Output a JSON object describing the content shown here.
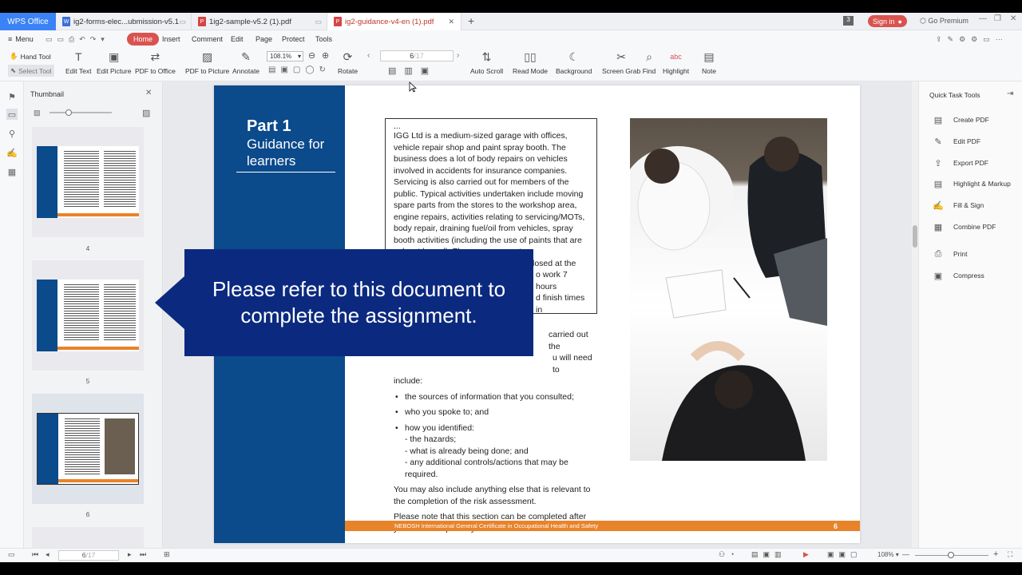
{
  "app": {
    "name": "WPS Office"
  },
  "tabs": [
    {
      "label": "ig2-forms-elec...ubmission-v5.1",
      "icon": "W"
    },
    {
      "label": "1ig2-sample-v5.2 (1).pdf",
      "icon": "P"
    },
    {
      "label": "ig2-guidance-v4-en (1).pdf",
      "icon": "P",
      "active": true
    }
  ],
  "window": {
    "tab_count": "3",
    "sign_in": "Sign in",
    "premium": "Go Premium"
  },
  "menu": {
    "label": "Menu",
    "items": [
      "Home",
      "Insert",
      "Comment",
      "Edit",
      "Page",
      "Protect",
      "Tools"
    ]
  },
  "toolbar": {
    "hand_tool": "Hand Tool",
    "select_tool": "Select Tool",
    "tools": [
      "Edit Text",
      "Edit Picture",
      "PDF to Office",
      "PDF to Picture",
      "Annotate"
    ],
    "zoom": "108.1%",
    "rotate": "Rotate",
    "page_current": "6",
    "page_total": "/17",
    "tools2": [
      "Auto Scroll",
      "Read Mode",
      "Background",
      "Screen Grab",
      "Find",
      "Highlight",
      "Note"
    ]
  },
  "thumbnail_panel": {
    "title": "Thumbnail",
    "pages": [
      "4",
      "5",
      "6"
    ]
  },
  "document": {
    "part_title": "Part 1",
    "part_subtitle_1": "Guidance for",
    "part_subtitle_2": "learners",
    "box_ellipsis": "...",
    "box_text": "IGG Ltd is a medium-sized garage with offices, vehicle repair shop and paint spray booth. The business does a lot of body repairs on vehicles involved in accidents for insurance companies. Servicing is also carried out for members of the public. Typical activities undertaken include moving spare parts from the stores to the workshop area, engine repairs, activities relating to servicing/MOTs, body repair, draining fuel/oil from vehicles, spray booth activities (including the use of paints that are solvent based). The garage operates",
    "box_text_tail_1": "losed at the",
    "box_text_tail_2": "o work 7 hours",
    "box_text_tail_3": "d finish times in",
    "body_tail_1": "carried out the",
    "body_tail_2": "u will need to",
    "body_include": "include:",
    "bullets": [
      "the sources of information that you consulted;",
      "who you spoke to; and",
      "how you identified:"
    ],
    "sub_items": [
      "- the hazards;",
      "- what is already being done; and",
      "- any additional controls/actions that may be required."
    ],
    "para1": "You may also include anything else that is relevant to the completion of the risk assessment.",
    "para2": "Please note that this section can be completed after you have completed your risk assessment.",
    "footer_text": "NEBOSH International General Certificate in Occupational Health and Safety",
    "footer_page": "6"
  },
  "callout": {
    "line1": "Please refer to this document to",
    "line2": "complete the assignment."
  },
  "quick_tools": {
    "title": "Quick Task Tools",
    "items": [
      "Create PDF",
      "Edit PDF",
      "Export PDF",
      "Highlight & Markup",
      "Fill & Sign",
      "Combine PDF",
      "Print",
      "Compress"
    ]
  },
  "statusbar": {
    "page": "6",
    "total": "/17",
    "zoom": "108%"
  },
  "colors": {
    "accent": "#d9534f",
    "doc_blue": "#0b4a8b",
    "doc_orange": "#e8832a",
    "callout": "#0b2a7f"
  }
}
